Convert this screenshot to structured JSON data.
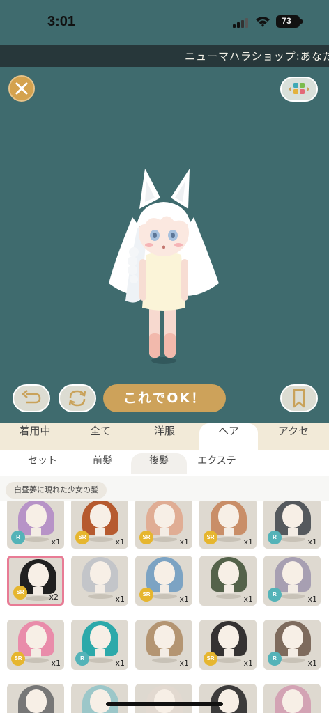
{
  "status": {
    "time": "3:01",
    "battery": "73"
  },
  "ticker": {
    "text": "ニューマハラショップ:あなたの"
  },
  "stage": {
    "ok_label": "これでOK！"
  },
  "main_tabs": [
    {
      "label": "着用中",
      "active": false
    },
    {
      "label": "全て",
      "active": false
    },
    {
      "label": "洋服",
      "active": false
    },
    {
      "label": "ヘア",
      "active": true
    },
    {
      "label": "アクセ",
      "active": false
    }
  ],
  "sub_tabs": [
    {
      "label": "セット",
      "active": false
    },
    {
      "label": "前髪",
      "active": false
    },
    {
      "label": "後髪",
      "active": true
    },
    {
      "label": "エクステ",
      "active": false
    }
  ],
  "item_name": "白昼夢に現れた少女の髪",
  "grid_items": [
    {
      "rarity": "R",
      "count": "x1",
      "hair_color": "#b793c7",
      "selected": false
    },
    {
      "rarity": "SR",
      "count": "x1",
      "hair_color": "#b65a2f",
      "selected": false
    },
    {
      "rarity": "SR",
      "count": "x1",
      "hair_color": "#e0ad94",
      "selected": false
    },
    {
      "rarity": "SR",
      "count": "x1",
      "hair_color": "#c98e68",
      "selected": false
    },
    {
      "rarity": "R",
      "count": "x1",
      "hair_color": "#55595d",
      "selected": false
    },
    {
      "rarity": "SR",
      "count": "x2",
      "hair_color": "#202020",
      "selected": true
    },
    {
      "rarity": "",
      "count": "x1",
      "hair_color": "#c3c5c9",
      "selected": false
    },
    {
      "rarity": "SR",
      "count": "x1",
      "hair_color": "#7ca3c3",
      "selected": false
    },
    {
      "rarity": "",
      "count": "x1",
      "hair_color": "#54624a",
      "selected": false
    },
    {
      "rarity": "R",
      "count": "x1",
      "hair_color": "#a79fb2",
      "selected": false
    },
    {
      "rarity": "SR",
      "count": "x1",
      "hair_color": "#e98caa",
      "selected": false
    },
    {
      "rarity": "R",
      "count": "x1",
      "hair_color": "#2ca9aa",
      "selected": false
    },
    {
      "rarity": "",
      "count": "x1",
      "hair_color": "#b49572",
      "selected": false
    },
    {
      "rarity": "SR",
      "count": "x1",
      "hair_color": "#353232",
      "selected": false
    },
    {
      "rarity": "R",
      "count": "x1",
      "hair_color": "#7e6b5d",
      "selected": false
    },
    {
      "rarity": "",
      "count": "",
      "hair_color": "#777777",
      "selected": false
    },
    {
      "rarity": "",
      "count": "",
      "hair_color": "#9cc7c9",
      "selected": false
    },
    {
      "rarity": "",
      "count": "",
      "hair_color": "#e2d9d0",
      "selected": false
    },
    {
      "rarity": "",
      "count": "",
      "hair_color": "#3c3b3b",
      "selected": false
    },
    {
      "rarity": "",
      "count": "",
      "hair_color": "#d3a3b4",
      "selected": false
    }
  ]
}
